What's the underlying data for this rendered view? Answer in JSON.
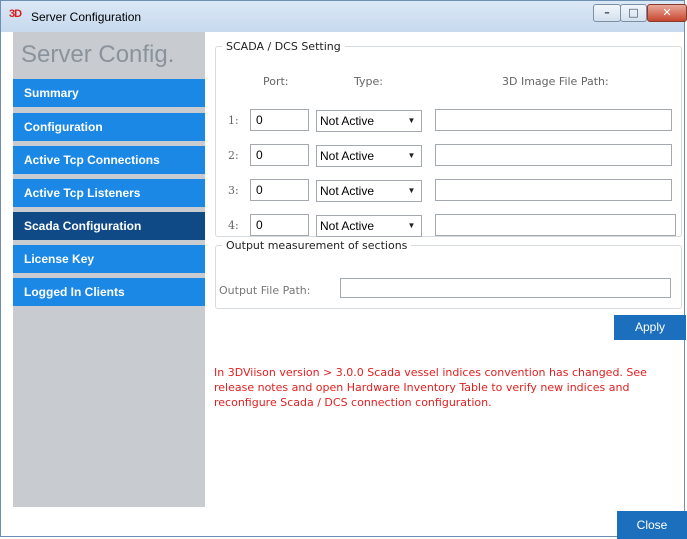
{
  "window": {
    "title": "Server Configuration",
    "app_icon_text": "3D",
    "controls": {
      "minimize_glyph": "–",
      "maximize_glyph": "□",
      "close_glyph": "✕"
    }
  },
  "sidebar": {
    "title": "Server Config.",
    "items": [
      {
        "label": "Summary",
        "active": false
      },
      {
        "label": "Configuration",
        "active": false
      },
      {
        "label": "Active Tcp Connections",
        "active": false
      },
      {
        "label": "Active Tcp Listeners",
        "active": false
      },
      {
        "label": "Scada Configuration",
        "active": true
      },
      {
        "label": "License Key",
        "active": false
      },
      {
        "label": "Logged In Clients",
        "active": false
      }
    ]
  },
  "scada": {
    "legend": "SCADA / DCS Setting",
    "headers": {
      "port": "Port:",
      "type": "Type:",
      "path": "3D Image File Path:"
    },
    "rows": [
      {
        "label": "1:",
        "port": "0",
        "type": "Not Active",
        "path": ""
      },
      {
        "label": "2:",
        "port": "0",
        "type": "Not Active",
        "path": ""
      },
      {
        "label": "3:",
        "port": "0",
        "type": "Not Active",
        "path": ""
      },
      {
        "label": "4:",
        "port": "0",
        "type": "Not Active",
        "path": ""
      }
    ]
  },
  "output": {
    "legend": "Output measurement of sections",
    "file_path_label": "Output File Path:",
    "file_path_value": ""
  },
  "buttons": {
    "apply": "Apply",
    "close": "Close"
  },
  "notice": "In 3DViison version > 3.0.0 Scada vessel indices convention has changed. See release notes and open Hardware Inventory Table to verify new indices and reconfigure Scada / DCS connection configuration.",
  "colors": {
    "nav_item": "#1c88e5",
    "nav_item_active": "#0f4a86",
    "button": "#1c6fbd",
    "notice_text": "#e02020",
    "sidebar_bg": "#c8ccd1"
  }
}
